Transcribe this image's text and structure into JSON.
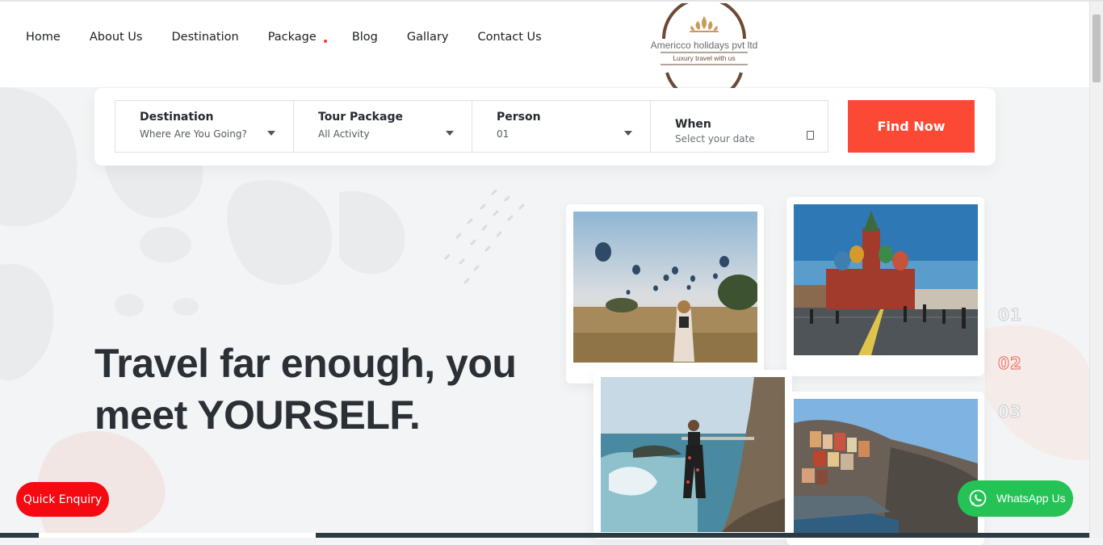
{
  "nav": {
    "items": [
      "Home",
      "About Us",
      "Destination",
      "Package",
      "Blog",
      "Gallary",
      "Contact Us"
    ]
  },
  "logo": {
    "name": "Americco holidays pvt ltd",
    "tagline": "Luxury travel with us"
  },
  "search": {
    "destination": {
      "label": "Destination",
      "value": "Where Are You Going?"
    },
    "package": {
      "label": "Tour Package",
      "value": "All Activity"
    },
    "person": {
      "label": "Person",
      "value": "01"
    },
    "when": {
      "label": "When",
      "placeholder": "Select your date"
    },
    "find_label": "Find Now"
  },
  "hero": {
    "line1": "Travel far enough, you",
    "line2": "meet YOURSELF."
  },
  "slider": {
    "counters": [
      "01",
      "02",
      "03"
    ],
    "active": "02"
  },
  "buttons": {
    "quick_enquiry": "Quick Enquiry",
    "whatsapp": "WhatsApp Us"
  },
  "colors": {
    "accent": "#fb4934",
    "quick_enquiry": "#f50a12",
    "whatsapp": "#25c256",
    "logo_brown": "#6b4a35"
  },
  "icons": [
    "dropdown-caret-icon",
    "calendar-icon",
    "whatsapp-icon"
  ]
}
